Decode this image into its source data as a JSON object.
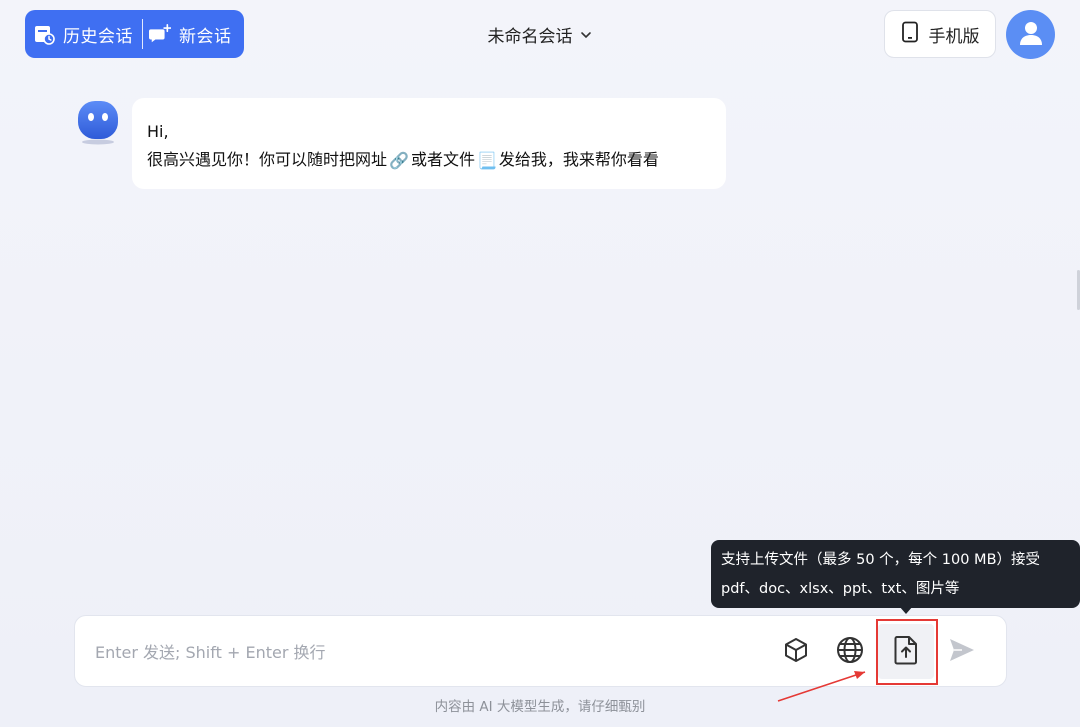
{
  "header": {
    "history_label": "历史会话",
    "new_chat_label": "新会话",
    "title": "未命名会话",
    "mobile_label": "手机版"
  },
  "conversation": {
    "messages": [
      {
        "role": "assistant",
        "line1": "Hi,",
        "line2_part1": "很高兴遇见你！你可以随时把网址",
        "line2_emoji1": "🔗",
        "line2_part2": "或者文件",
        "line2_emoji2": "📃",
        "line2_part3": "发给我，我来帮你看看"
      }
    ]
  },
  "tooltip": {
    "line1": "支持上传文件（最多 50 个，每个 100 MB）接受",
    "line2": "pdf、doc、xlsx、ppt、txt、图片等"
  },
  "composer": {
    "placeholder": "Enter 发送; Shift + Enter 换行",
    "value": ""
  },
  "footer": {
    "disclaimer": "内容由 AI 大模型生成，请仔细甄别"
  },
  "colors": {
    "accent": "#3f6ff2",
    "avatar": "#5b8ef4",
    "tooltip_bg": "#1f232b",
    "highlight": "#e53935",
    "background": "#f1f3f9"
  },
  "icons": {
    "history": "history-icon",
    "new_chat": "new-chat-icon",
    "dropdown": "chevron-down-icon",
    "mobile": "phone-icon",
    "user": "user-avatar-icon",
    "bot": "bot-avatar-icon",
    "model": "cube-icon",
    "web": "globe-icon",
    "upload": "upload-file-icon",
    "send": "send-icon"
  }
}
